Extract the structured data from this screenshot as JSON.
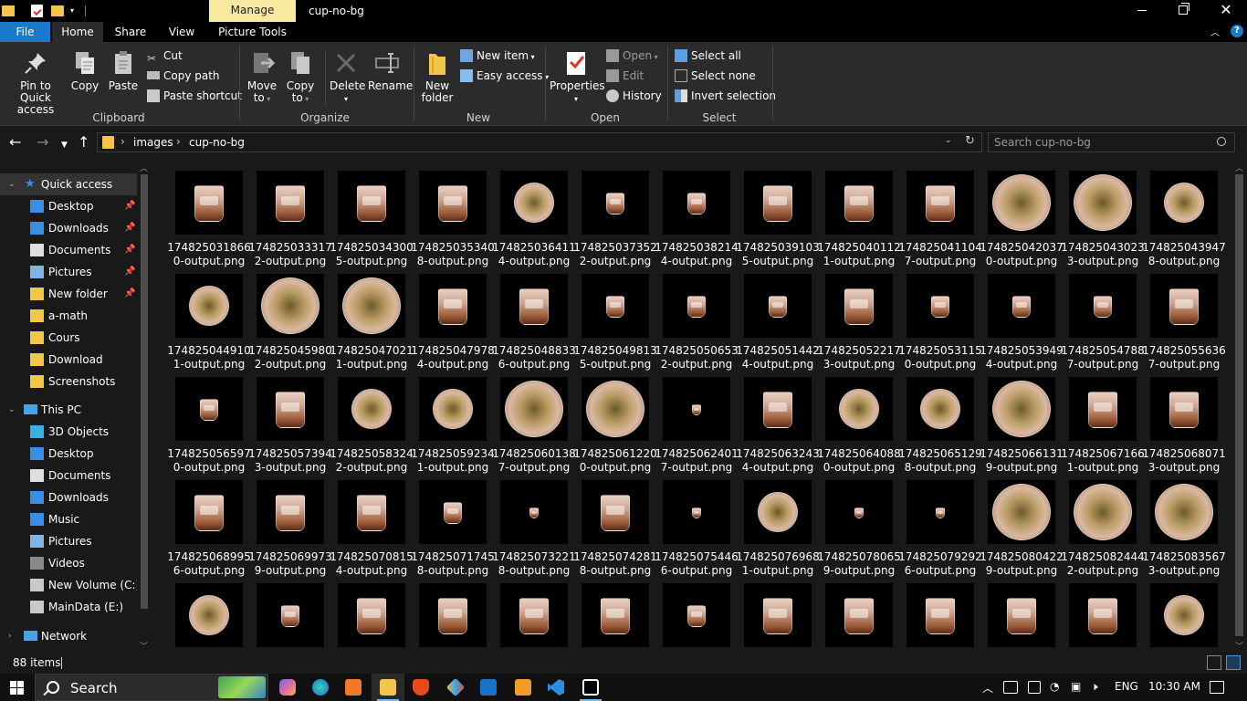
{
  "window": {
    "manage_tab": "Manage",
    "title": "cup-no-bg"
  },
  "tabs": {
    "file": "File",
    "home": "Home",
    "share": "Share",
    "view": "View",
    "picture_tools": "Picture Tools"
  },
  "ribbon": {
    "clipboard": {
      "group_label": "Clipboard",
      "pin_line1": "Pin to Quick",
      "pin_line2": "access",
      "copy": "Copy",
      "paste": "Paste",
      "cut": "Cut",
      "copy_path": "Copy path",
      "paste_shortcut": "Paste shortcut"
    },
    "organize": {
      "group_label": "Organize",
      "move_line1": "Move",
      "move_line2": "to",
      "copy_line1": "Copy",
      "copy_line2": "to",
      "delete": "Delete",
      "rename": "Rename"
    },
    "new": {
      "group_label": "New",
      "new_folder_line1": "New",
      "new_folder_line2": "folder",
      "new_item": "New item",
      "easy_access": "Easy access"
    },
    "open": {
      "group_label": "Open",
      "properties": "Properties",
      "open": "Open",
      "edit": "Edit",
      "history": "History"
    },
    "select": {
      "group_label": "Select",
      "select_all": "Select all",
      "select_none": "Select none",
      "invert_selection": "Invert selection"
    }
  },
  "address": {
    "crumbs": [
      "images",
      "cup-no-bg"
    ],
    "search_placeholder": "Search cup-no-bg"
  },
  "nav": {
    "quick_access": "Quick access",
    "quick_items": [
      "Desktop",
      "Downloads",
      "Documents",
      "Pictures",
      "New folder",
      "a-math",
      "Cours",
      "Download",
      "Screenshots"
    ],
    "this_pc": "This PC",
    "pc_items": [
      "3D Objects",
      "Desktop",
      "Documents",
      "Downloads",
      "Music",
      "Pictures",
      "Videos",
      "New Volume (C:)",
      "MainData (E:)"
    ],
    "network": "Network"
  },
  "files": [
    {
      "line1": "174825031866",
      "line2": "0-output.png"
    },
    {
      "line1": "174825033317",
      "line2": "2-output.png"
    },
    {
      "line1": "174825034300",
      "line2": "5-output.png"
    },
    {
      "line1": "174825035340",
      "line2": "8-output.png"
    },
    {
      "line1": "174825036411",
      "line2": "4-output.png"
    },
    {
      "line1": "174825037352",
      "line2": "2-output.png"
    },
    {
      "line1": "174825038214",
      "line2": "4-output.png"
    },
    {
      "line1": "174825039103",
      "line2": "5-output.png"
    },
    {
      "line1": "174825040112",
      "line2": "1-output.png"
    },
    {
      "line1": "174825041104",
      "line2": "7-output.png"
    },
    {
      "line1": "174825042037",
      "line2": "0-output.png"
    },
    {
      "line1": "174825043023",
      "line2": "3-output.png"
    },
    {
      "line1": "174825043947",
      "line2": "8-output.png"
    },
    {
      "line1": "174825044910",
      "line2": "1-output.png"
    },
    {
      "line1": "174825045980",
      "line2": "2-output.png"
    },
    {
      "line1": "174825047021",
      "line2": "1-output.png"
    },
    {
      "line1": "174825047978",
      "line2": "4-output.png"
    },
    {
      "line1": "174825048833",
      "line2": "6-output.png"
    },
    {
      "line1": "174825049813",
      "line2": "5-output.png"
    },
    {
      "line1": "174825050653",
      "line2": "2-output.png"
    },
    {
      "line1": "174825051442",
      "line2": "4-output.png"
    },
    {
      "line1": "174825052217",
      "line2": "3-output.png"
    },
    {
      "line1": "174825053115",
      "line2": "0-output.png"
    },
    {
      "line1": "174825053949",
      "line2": "4-output.png"
    },
    {
      "line1": "174825054788",
      "line2": "7-output.png"
    },
    {
      "line1": "174825055636",
      "line2": "7-output.png"
    },
    {
      "line1": "174825056597",
      "line2": "0-output.png"
    },
    {
      "line1": "174825057394",
      "line2": "3-output.png"
    },
    {
      "line1": "174825058324",
      "line2": "2-output.png"
    },
    {
      "line1": "174825059234",
      "line2": "1-output.png"
    },
    {
      "line1": "174825060138",
      "line2": "7-output.png"
    },
    {
      "line1": "174825061220",
      "line2": "0-output.png"
    },
    {
      "line1": "174825062401",
      "line2": "7-output.png"
    },
    {
      "line1": "174825063243",
      "line2": "4-output.png"
    },
    {
      "line1": "174825064088",
      "line2": "0-output.png"
    },
    {
      "line1": "174825065129",
      "line2": "8-output.png"
    },
    {
      "line1": "174825066131",
      "line2": "9-output.png"
    },
    {
      "line1": "174825067166",
      "line2": "1-output.png"
    },
    {
      "line1": "174825068071",
      "line2": "3-output.png"
    },
    {
      "line1": "174825068995",
      "line2": "6-output.png"
    },
    {
      "line1": "174825069973",
      "line2": "9-output.png"
    },
    {
      "line1": "174825070815",
      "line2": "4-output.png"
    },
    {
      "line1": "174825071745",
      "line2": "8-output.png"
    },
    {
      "line1": "174825073221",
      "line2": "8-output.png"
    },
    {
      "line1": "174825074281",
      "line2": "8-output.png"
    },
    {
      "line1": "174825075446",
      "line2": "6-output.png"
    },
    {
      "line1": "174825076968",
      "line2": "1-output.png"
    },
    {
      "line1": "174825078065",
      "line2": "9-output.png"
    },
    {
      "line1": "174825079292",
      "line2": "6-output.png"
    },
    {
      "line1": "174825080422",
      "line2": "9-output.png"
    },
    {
      "line1": "174825082444",
      "line2": "2-output.png"
    },
    {
      "line1": "174825083567",
      "line2": "3-output.png"
    },
    {
      "line1": "",
      "line2": ""
    },
    {
      "line1": "",
      "line2": ""
    },
    {
      "line1": "",
      "line2": ""
    },
    {
      "line1": "",
      "line2": ""
    },
    {
      "line1": "",
      "line2": ""
    },
    {
      "line1": "",
      "line2": ""
    },
    {
      "line1": "",
      "line2": ""
    },
    {
      "line1": "",
      "line2": ""
    },
    {
      "line1": "",
      "line2": ""
    },
    {
      "line1": "",
      "line2": ""
    },
    {
      "line1": "",
      "line2": ""
    },
    {
      "line1": "",
      "line2": ""
    },
    {
      "line1": "",
      "line2": ""
    }
  ],
  "status": {
    "item_count": "88 items"
  },
  "taskbar": {
    "search_label": "Search",
    "language": "ENG",
    "time": "10:30 AM"
  },
  "colors": {
    "accent": "#1979ca",
    "manage_tab": "#f8e9a1",
    "folder": "#f4c54b"
  }
}
